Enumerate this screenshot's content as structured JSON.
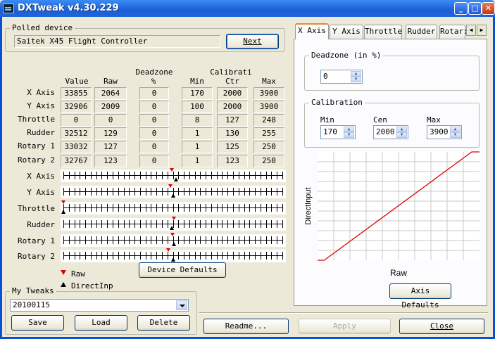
{
  "window": {
    "title": "DXTweak v4.30.229",
    "minimize": "_",
    "maximize": "□",
    "close": "✕"
  },
  "polled": {
    "group": "Polled device",
    "device": "Saitek X45 Flight Controller",
    "next": "Next"
  },
  "table": {
    "headers": {
      "value": "Value",
      "raw": "Raw",
      "deadzone_top": "Deadzone",
      "deadzone_bot": "%",
      "calib_top": "Calibrati",
      "min": "Min",
      "ctr": "Ctr",
      "max": "Max"
    },
    "rows": [
      {
        "name": "X Axis",
        "value": "33855",
        "raw": "2064",
        "dz": "0",
        "min": "170",
        "ctr": "2000",
        "max": "3900"
      },
      {
        "name": "Y Axis",
        "value": "32906",
        "raw": "2009",
        "dz": "0",
        "min": "100",
        "ctr": "2000",
        "max": "3900"
      },
      {
        "name": "Throttle",
        "value": "0",
        "raw": "0",
        "dz": "0",
        "min": "8",
        "ctr": "127",
        "max": "248"
      },
      {
        "name": "Rudder",
        "value": "32512",
        "raw": "129",
        "dz": "0",
        "min": "1",
        "ctr": "130",
        "max": "255"
      },
      {
        "name": "Rotary 1",
        "value": "33032",
        "raw": "127",
        "dz": "0",
        "min": "1",
        "ctr": "125",
        "max": "250"
      },
      {
        "name": "Rotary 2",
        "value": "32767",
        "raw": "123",
        "dz": "0",
        "min": "1",
        "ctr": "123",
        "max": "250"
      }
    ]
  },
  "sliders": [
    {
      "name": "X Axis",
      "raw": 0.495,
      "di": 0.515
    },
    {
      "name": "Y Axis",
      "raw": 0.488,
      "di": 0.502
    },
    {
      "name": "Throttle",
      "raw": 0.0,
      "di": 0.0
    },
    {
      "name": "Rudder",
      "raw": 0.505,
      "di": 0.496
    },
    {
      "name": "Rotary 1",
      "raw": 0.497,
      "di": 0.504
    },
    {
      "name": "Rotary 2",
      "raw": 0.48,
      "di": 0.5
    }
  ],
  "legend": {
    "raw": "Raw",
    "di": "DirectInp",
    "raw_color": "#e00000",
    "di_color": "#000000"
  },
  "device_defaults": "Device Defaults",
  "tweaks": {
    "group": "My Tweaks",
    "selected": "20100115",
    "save": "Save",
    "load": "Load",
    "delete": "Delete"
  },
  "tabs": [
    {
      "label": "X Axis",
      "active": true
    },
    {
      "label": "Y Axis",
      "active": false
    },
    {
      "label": "Throttle",
      "active": false
    },
    {
      "label": "Rudder",
      "active": false
    },
    {
      "label": "Rotar:",
      "active": false
    }
  ],
  "panel": {
    "deadzone_group": "Deadzone (in %)",
    "deadzone_value": "0",
    "calib_group": "Calibration",
    "min_label": "Min",
    "cen_label": "Cen",
    "max_label": "Max",
    "min_value": "170",
    "cen_value": "2000",
    "max_value": "3900",
    "axis_defaults": "Axis Defaults"
  },
  "chart_data": {
    "type": "line",
    "xlabel": "Raw",
    "ylabel": "DirectInput",
    "x": [
      0,
      170,
      3900,
      4095
    ],
    "y": [
      0,
      0,
      65535,
      65535
    ],
    "xlim": [
      0,
      4095
    ],
    "ylim": [
      0,
      65535
    ],
    "grid": true,
    "line_color": "#e00000"
  },
  "footer": {
    "readme": "Readme...",
    "apply": "Apply",
    "close": "Close"
  }
}
